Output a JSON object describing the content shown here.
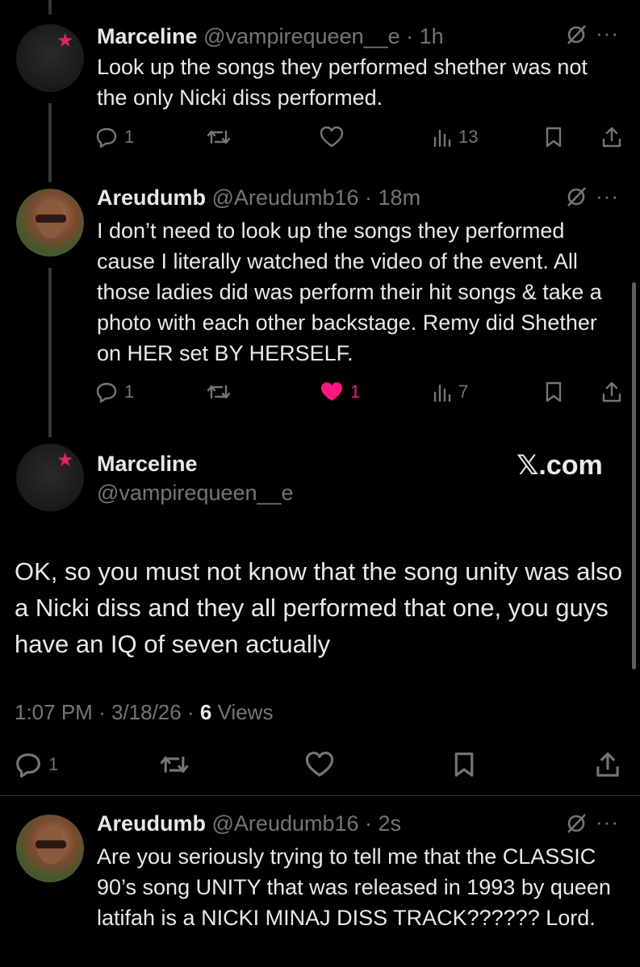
{
  "tweets": [
    {
      "name": "Marceline",
      "handle": "@vampirequeen__e",
      "time": "· 1h",
      "text": "Look up the songs they performed shether was not the only Nicki diss performed.",
      "replies": "1",
      "likes": "",
      "views": "13"
    },
    {
      "name": "Areudumb",
      "handle": "@Areudumb16",
      "time": "· 18m",
      "text": "I don’t need to look up the songs they performed cause I literally watched the video of the event. All those ladies did was perform their hit songs & take a photo with each other backstage. Remy did Shether on HER set BY HERSELF.",
      "replies": "1",
      "likes": "1",
      "views": "7"
    }
  ],
  "main_tweet": {
    "name": "Marceline",
    "handle": "@vampirequeen__e",
    "watermark": "𝕏.com",
    "text": "OK, so you must not know that the song unity was also a Nicki diss and they all performed that one, you guys have an IQ of seven actually",
    "time": "1:07 PM",
    "date": "3/18/26",
    "views_count": "6",
    "views_label": "Views",
    "replies": "1"
  },
  "reply": {
    "name": "Areudumb",
    "handle": "@Areudumb16",
    "time": "· 2s",
    "text": "Are you seriously trying to tell me that the CLASSIC 90’s song UNITY that was released in 1993 by queen latifah is a NICKI MINAJ DISS TRACK?????? Lord."
  },
  "colors": {
    "like_active": "#f91880",
    "muted": "#71767b",
    "star": "#e0245e"
  }
}
